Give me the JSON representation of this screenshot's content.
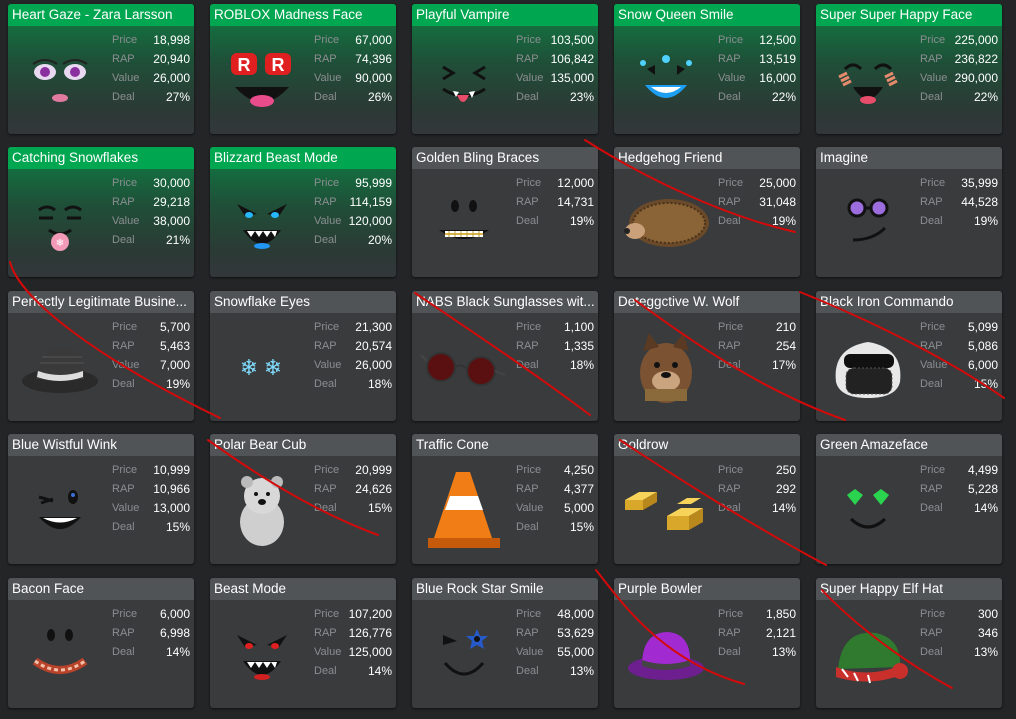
{
  "items": [
    {
      "name": "Heart Gaze - Zara Larsson",
      "style": "green",
      "icon": "heart-gaze-face-icon",
      "stats": [
        {
          "label": "Price",
          "value": "18,998"
        },
        {
          "label": "RAP",
          "value": "20,940"
        },
        {
          "label": "Value",
          "value": "26,000"
        },
        {
          "label": "Deal",
          "value": "27%"
        }
      ]
    },
    {
      "name": "ROBLOX Madness Face",
      "style": "green",
      "icon": "madness-face-icon",
      "stats": [
        {
          "label": "Price",
          "value": "67,000"
        },
        {
          "label": "RAP",
          "value": "74,396"
        },
        {
          "label": "Value",
          "value": "90,000"
        },
        {
          "label": "Deal",
          "value": "26%"
        }
      ]
    },
    {
      "name": "Playful Vampire",
      "style": "green",
      "icon": "vampire-face-icon",
      "stats": [
        {
          "label": "Price",
          "value": "103,500"
        },
        {
          "label": "RAP",
          "value": "106,842"
        },
        {
          "label": "Value",
          "value": "135,000"
        },
        {
          "label": "Deal",
          "value": "23%"
        }
      ]
    },
    {
      "name": "Snow Queen Smile",
      "style": "green",
      "icon": "snow-queen-face-icon",
      "stats": [
        {
          "label": "Price",
          "value": "12,500"
        },
        {
          "label": "RAP",
          "value": "13,519"
        },
        {
          "label": "Value",
          "value": "16,000"
        },
        {
          "label": "Deal",
          "value": "22%"
        }
      ]
    },
    {
      "name": "Super Super Happy Face",
      "style": "green",
      "icon": "super-happy-face-icon",
      "stats": [
        {
          "label": "Price",
          "value": "225,000"
        },
        {
          "label": "RAP",
          "value": "236,822"
        },
        {
          "label": "Value",
          "value": "290,000"
        },
        {
          "label": "Deal",
          "value": "22%"
        }
      ]
    },
    {
      "name": "Catching Snowflakes",
      "style": "green",
      "icon": "catching-snowflakes-face-icon",
      "stats": [
        {
          "label": "Price",
          "value": "30,000"
        },
        {
          "label": "RAP",
          "value": "29,218"
        },
        {
          "label": "Value",
          "value": "38,000"
        },
        {
          "label": "Deal",
          "value": "21%"
        }
      ]
    },
    {
      "name": "Blizzard Beast Mode",
      "style": "green",
      "icon": "blizzard-beast-face-icon",
      "stats": [
        {
          "label": "Price",
          "value": "95,999"
        },
        {
          "label": "RAP",
          "value": "114,159"
        },
        {
          "label": "Value",
          "value": "120,000"
        },
        {
          "label": "Deal",
          "value": "20%"
        }
      ]
    },
    {
      "name": "Golden Bling Braces",
      "style": "gray",
      "icon": "braces-face-icon",
      "stats": [
        {
          "label": "Price",
          "value": "12,000"
        },
        {
          "label": "RAP",
          "value": "14,731"
        },
        {
          "label": "Deal",
          "value": "19%"
        }
      ]
    },
    {
      "name": "Hedgehog Friend",
      "style": "gray",
      "icon": "hedgehog-icon",
      "stats": [
        {
          "label": "Price",
          "value": "25,000"
        },
        {
          "label": "RAP",
          "value": "31,048"
        },
        {
          "label": "Deal",
          "value": "19%"
        }
      ]
    },
    {
      "name": "Imagine",
      "style": "gray",
      "icon": "imagine-face-icon",
      "stats": [
        {
          "label": "Price",
          "value": "35,999"
        },
        {
          "label": "RAP",
          "value": "44,528"
        },
        {
          "label": "Deal",
          "value": "19%"
        }
      ]
    },
    {
      "name": "Perfectly Legitimate Busine...",
      "style": "gray",
      "icon": "fedora-hat-icon",
      "stats": [
        {
          "label": "Price",
          "value": "5,700"
        },
        {
          "label": "RAP",
          "value": "5,463"
        },
        {
          "label": "Value",
          "value": "7,000"
        },
        {
          "label": "Deal",
          "value": "19%"
        }
      ]
    },
    {
      "name": "Snowflake Eyes",
      "style": "gray",
      "icon": "snowflake-eyes-icon",
      "stats": [
        {
          "label": "Price",
          "value": "21,300"
        },
        {
          "label": "RAP",
          "value": "20,574"
        },
        {
          "label": "Value",
          "value": "26,000"
        },
        {
          "label": "Deal",
          "value": "18%"
        }
      ]
    },
    {
      "name": "NABS Black Sunglasses wit...",
      "style": "gray",
      "icon": "sunglasses-icon",
      "stats": [
        {
          "label": "Price",
          "value": "1,100"
        },
        {
          "label": "RAP",
          "value": "1,335"
        },
        {
          "label": "Deal",
          "value": "18%"
        }
      ]
    },
    {
      "name": "Deteggctive W. Wolf",
      "style": "gray",
      "icon": "wolf-egg-icon",
      "stats": [
        {
          "label": "Price",
          "value": "210"
        },
        {
          "label": "RAP",
          "value": "254"
        },
        {
          "label": "Deal",
          "value": "17%"
        }
      ]
    },
    {
      "name": "Black Iron Commando",
      "style": "gray",
      "icon": "commando-helmet-icon",
      "stats": [
        {
          "label": "Price",
          "value": "5,099"
        },
        {
          "label": "RAP",
          "value": "5,086"
        },
        {
          "label": "Value",
          "value": "6,000"
        },
        {
          "label": "Deal",
          "value": "15%"
        }
      ]
    },
    {
      "name": "Blue Wistful Wink",
      "style": "gray",
      "icon": "wink-face-icon",
      "stats": [
        {
          "label": "Price",
          "value": "10,999"
        },
        {
          "label": "RAP",
          "value": "10,966"
        },
        {
          "label": "Value",
          "value": "13,000"
        },
        {
          "label": "Deal",
          "value": "15%"
        }
      ]
    },
    {
      "name": "Polar Bear Cub",
      "style": "gray",
      "icon": "polar-bear-icon",
      "stats": [
        {
          "label": "Price",
          "value": "20,999"
        },
        {
          "label": "RAP",
          "value": "24,626"
        },
        {
          "label": "Deal",
          "value": "15%"
        }
      ]
    },
    {
      "name": "Traffic Cone",
      "style": "gray",
      "icon": "traffic-cone-icon",
      "stats": [
        {
          "label": "Price",
          "value": "4,250"
        },
        {
          "label": "RAP",
          "value": "4,377"
        },
        {
          "label": "Value",
          "value": "5,000"
        },
        {
          "label": "Deal",
          "value": "15%"
        }
      ]
    },
    {
      "name": "Goldrow",
      "style": "gray",
      "icon": "gold-bars-icon",
      "stats": [
        {
          "label": "Price",
          "value": "250"
        },
        {
          "label": "RAP",
          "value": "292"
        },
        {
          "label": "Deal",
          "value": "14%"
        }
      ]
    },
    {
      "name": "Green Amazeface",
      "style": "gray",
      "icon": "amazeface-icon",
      "stats": [
        {
          "label": "Price",
          "value": "4,499"
        },
        {
          "label": "RAP",
          "value": "5,228"
        },
        {
          "label": "Deal",
          "value": "14%"
        }
      ]
    },
    {
      "name": "Bacon Face",
      "style": "gray",
      "icon": "bacon-face-icon",
      "stats": [
        {
          "label": "Price",
          "value": "6,000"
        },
        {
          "label": "RAP",
          "value": "6,998"
        },
        {
          "label": "Deal",
          "value": "14%"
        }
      ]
    },
    {
      "name": "Beast Mode",
      "style": "gray",
      "icon": "beast-mode-face-icon",
      "stats": [
        {
          "label": "Price",
          "value": "107,200"
        },
        {
          "label": "RAP",
          "value": "126,776"
        },
        {
          "label": "Value",
          "value": "125,000"
        },
        {
          "label": "Deal",
          "value": "14%"
        }
      ]
    },
    {
      "name": "Blue Rock Star Smile",
      "style": "gray",
      "icon": "rock-star-face-icon",
      "stats": [
        {
          "label": "Price",
          "value": "48,000"
        },
        {
          "label": "RAP",
          "value": "53,629"
        },
        {
          "label": "Value",
          "value": "55,000"
        },
        {
          "label": "Deal",
          "value": "13%"
        }
      ]
    },
    {
      "name": "Purple Bowler",
      "style": "gray",
      "icon": "bowler-hat-icon",
      "stats": [
        {
          "label": "Price",
          "value": "1,850"
        },
        {
          "label": "RAP",
          "value": "2,121"
        },
        {
          "label": "Deal",
          "value": "13%"
        }
      ]
    },
    {
      "name": "Super Happy Elf Hat",
      "style": "gray",
      "icon": "elf-hat-icon",
      "stats": [
        {
          "label": "Price",
          "value": "300"
        },
        {
          "label": "RAP",
          "value": "346"
        },
        {
          "label": "Deal",
          "value": "13%"
        }
      ]
    }
  ],
  "annotation_color": "#d40a0a"
}
